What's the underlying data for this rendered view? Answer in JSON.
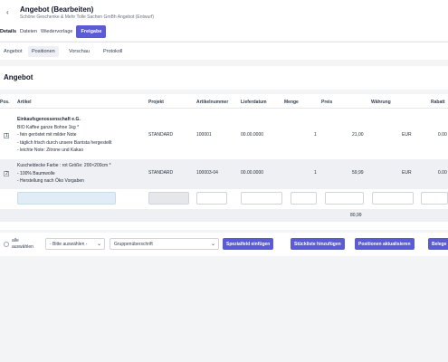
{
  "header": {
    "back_icon": "‹",
    "title": "Angebot (Bearbeiten)",
    "subtitle": "Schöne Geschenke & Mehr Tolle Sachen GmBh Angebot (Entwurf)"
  },
  "tabs": {
    "details": "Details",
    "dateien": "Dateien",
    "wiedervorlage": "Wiedervorlage",
    "freigabe": "Freigabe"
  },
  "subnav": {
    "angebot": "Angebot",
    "positionen": "Positionen",
    "vorschau": "Vorschau",
    "protokoll": "Protokoll"
  },
  "section_title": "Angebot",
  "table": {
    "headers": {
      "pos": "Pos.",
      "artikel": "Artikel",
      "projekt": "Projekt",
      "artikelnummer": "Artikelnummer",
      "lieferdatum": "Lieferdatum",
      "menge": "Menge",
      "preis": "Preis",
      "waehrung": "Währung",
      "rabatt": "Rabatt"
    },
    "rows": [
      {
        "pos": "1",
        "company": "Einkaufsgenossenschaft e.G.",
        "lines": [
          "BIO Kaffee ganze Bohne 1kg *",
          "- fein geröstet mit milder Note",
          "- täglich frisch durch unsere Barrista hergestellt",
          "- leichte Note: Zitrone und Kakao"
        ],
        "projekt": "STANDARD",
        "artikelnummer": "100001",
        "lieferdatum": "00.00.0000",
        "menge": "1",
        "preis": "21,00",
        "waehrung": "EUR",
        "rabatt": "0.00"
      },
      {
        "pos": "2",
        "lines": [
          "Kuscheldecke Farbe : rot Größe: 200×200cm *",
          "- 100% Baumwolle",
          "- Herstellung nach Öko Vorgaben"
        ],
        "projekt": "STANDARD",
        "artikelnummer": "100003-04",
        "lieferdatum": "00.00.0000",
        "menge": "1",
        "preis": "59,99",
        "waehrung": "EUR",
        "rabatt": "0.00"
      }
    ],
    "sum": "80,99"
  },
  "footer": {
    "alle_auswaehlen": "alle auswählen",
    "select_placeholder": "- Bitte auswählen -",
    "group_select": "Gruppenüberschrift",
    "btn_spezialfeld": "Spezialfeld einfügen",
    "btn_stueckliste": "Stückliste hinzufügen",
    "btn_positionen": "Positionen aktualisieren",
    "btn_belege": "Belege"
  }
}
